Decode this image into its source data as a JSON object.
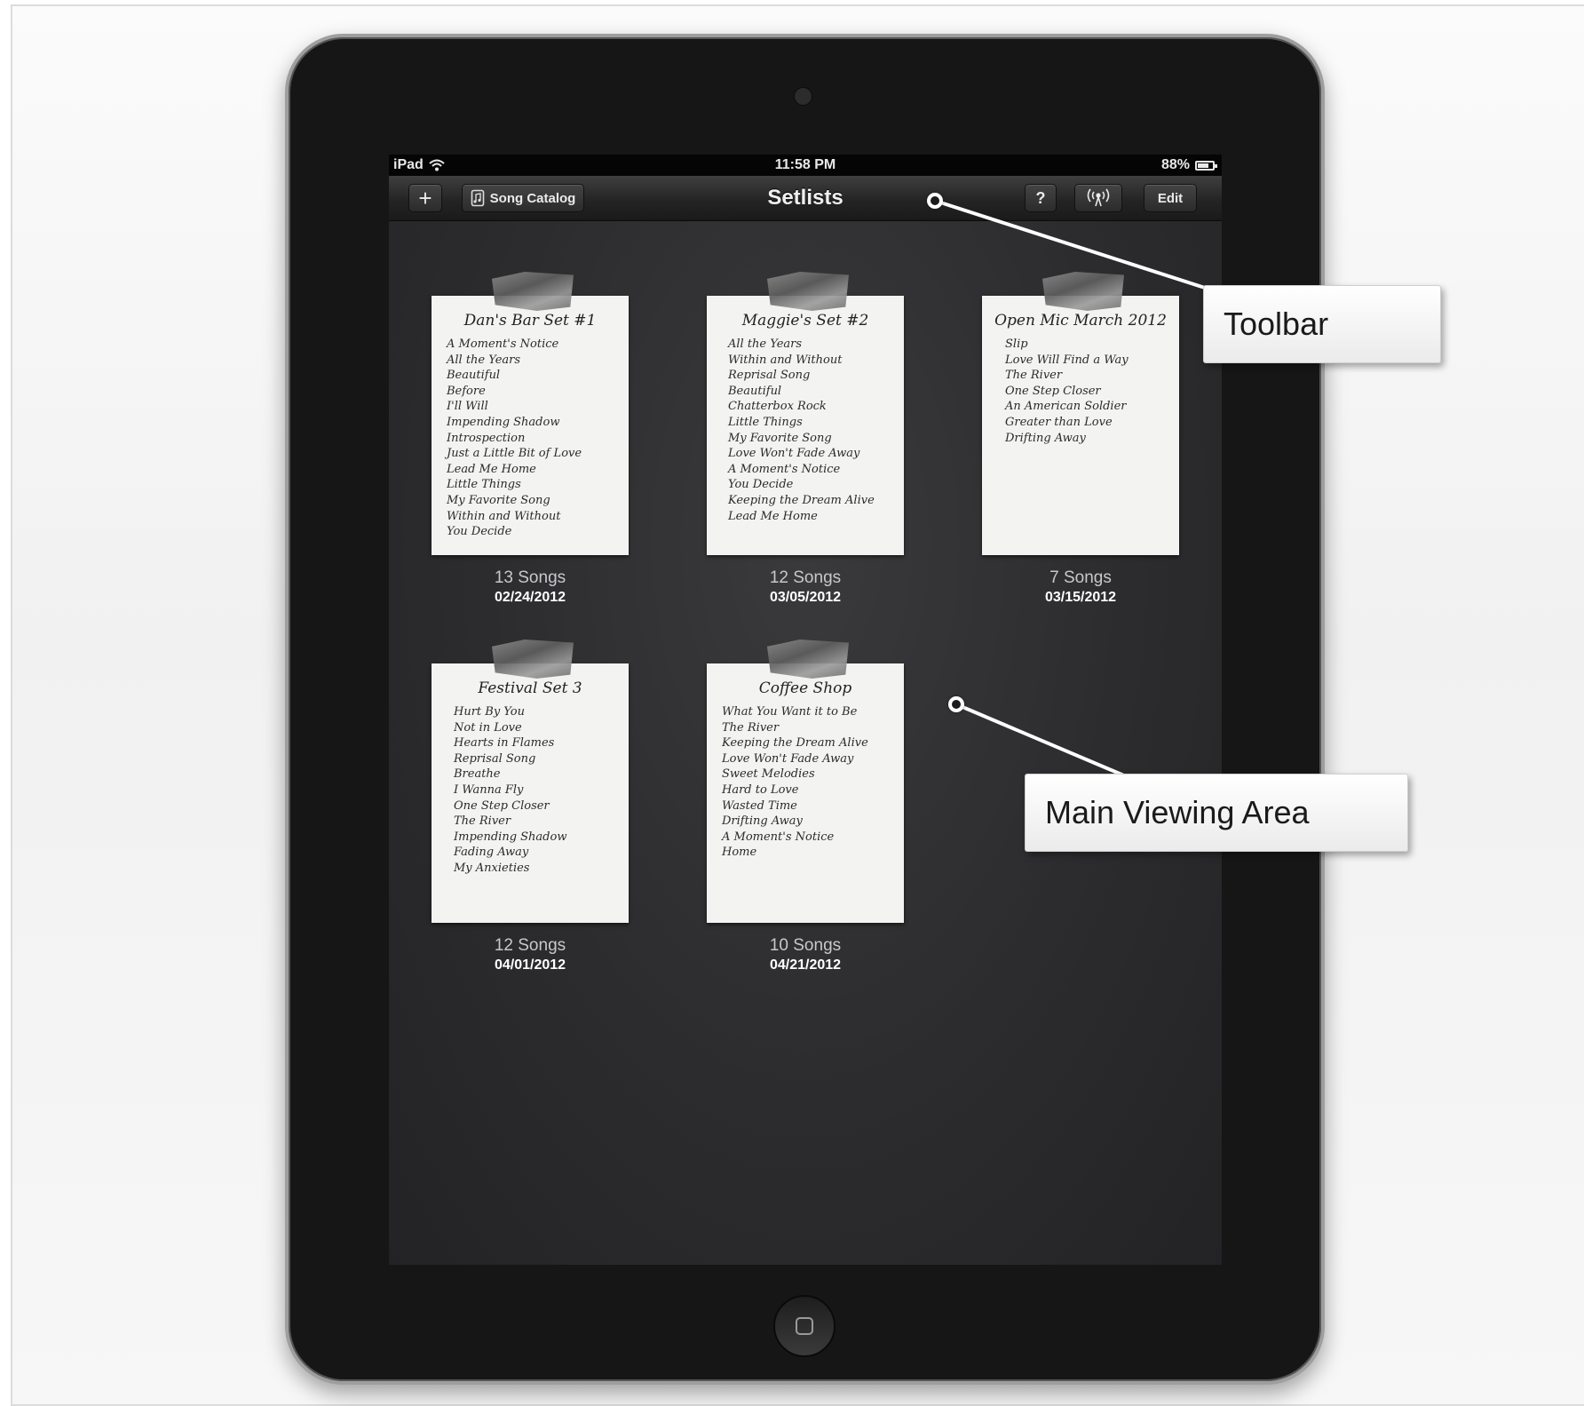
{
  "status_bar": {
    "device": "iPad",
    "time": "11:58 PM",
    "battery": "88%",
    "battery_level": 0.88,
    "wifi_icon": "wifi-icon"
  },
  "toolbar": {
    "add_label": "+",
    "song_catalog_label": "Song Catalog",
    "title": "Setlists",
    "help_label": "?",
    "broadcast_icon": "broadcast-icon",
    "edit_label": "Edit"
  },
  "setlists": [
    {
      "title": "Dan's Bar Set #1",
      "songs": [
        "A Moment's Notice",
        "All the Years",
        "Beautiful",
        "Before",
        "I'll Will",
        "Impending Shadow",
        "Introspection",
        "Just a Little Bit of Love",
        "Lead Me Home",
        "Little Things",
        "My Favorite Song",
        "Within and Without",
        "You Decide"
      ],
      "count": "13 Songs",
      "date": "02/24/2012"
    },
    {
      "title": "Maggie's Set #2",
      "songs": [
        "All the Years",
        "Within and Without",
        "Reprisal Song",
        "Beautiful",
        "Chatterbox Rock",
        "Little Things",
        "My Favorite Song",
        "Love Won't Fade Away",
        "A Moment's Notice",
        "You Decide",
        "Keeping the Dream Alive",
        "Lead Me Home"
      ],
      "count": "12 Songs",
      "date": "03/05/2012"
    },
    {
      "title": "Open Mic March 2012",
      "songs": [
        "Slip",
        "Love Will Find a Way",
        "The River",
        "One Step Closer",
        "An American Soldier",
        "Greater than Love",
        "Drifting Away"
      ],
      "count": "7 Songs",
      "date": "03/15/2012"
    },
    {
      "title": "Festival Set 3",
      "songs": [
        "Hurt By You",
        "Not in Love",
        "Hearts in Flames",
        "Reprisal Song",
        "Breathe",
        "I Wanna Fly",
        "One Step Closer",
        "The River",
        "Impending Shadow",
        "Fading Away",
        "My Anxieties"
      ],
      "count": "12 Songs",
      "date": "04/01/2012"
    },
    {
      "title": "Coffee Shop",
      "songs": [
        "What You Want it to Be",
        "The River",
        "Keeping the Dream Alive",
        "Love Won't Fade Away",
        "Sweet Melodies",
        "Hard to Love",
        "Wasted Time",
        "Drifting Away",
        "A Moment's Notice",
        "Home"
      ],
      "count": "10 Songs",
      "date": "04/21/2012"
    }
  ],
  "callouts": {
    "toolbar": "Toolbar",
    "main_area": "Main Viewing Area"
  }
}
